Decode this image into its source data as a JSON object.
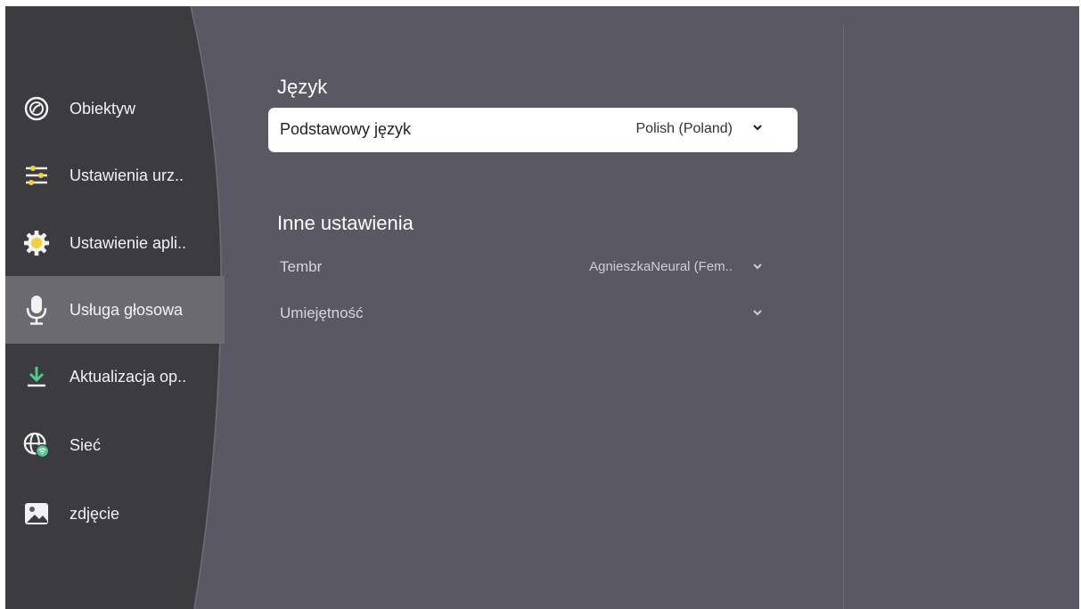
{
  "sidebar": {
    "items": [
      {
        "label": "Obiektyw",
        "icon": "lens-icon"
      },
      {
        "label": "Ustawienia urz..",
        "icon": "sliders-icon"
      },
      {
        "label": "Ustawienie apli..",
        "icon": "gear-icon"
      },
      {
        "label": "Usługa głosowa",
        "icon": "microphone-icon",
        "active": true
      },
      {
        "label": "Aktualizacja op..",
        "icon": "download-icon"
      },
      {
        "label": "Sieć",
        "icon": "globe-wifi-icon"
      },
      {
        "label": "zdjęcie",
        "icon": "image-icon"
      }
    ]
  },
  "main": {
    "language_section": {
      "title": "Język",
      "primary_language_label": "Podstawowy język",
      "primary_language_value": "Polish (Poland)"
    },
    "other_section": {
      "title": "Inne ustawienia",
      "rows": [
        {
          "label": "Tembr",
          "value": "AgnieszkaNeural (Fem.."
        },
        {
          "label": "Umiejętność",
          "value": ""
        }
      ]
    }
  },
  "colors": {
    "background": "#5a5862",
    "sidebar": "#3c3b40",
    "active_item": "#6b6a71",
    "card": "#ffffff",
    "accent_green": "#4fc98a",
    "accent_yellow": "#f4d13b"
  }
}
